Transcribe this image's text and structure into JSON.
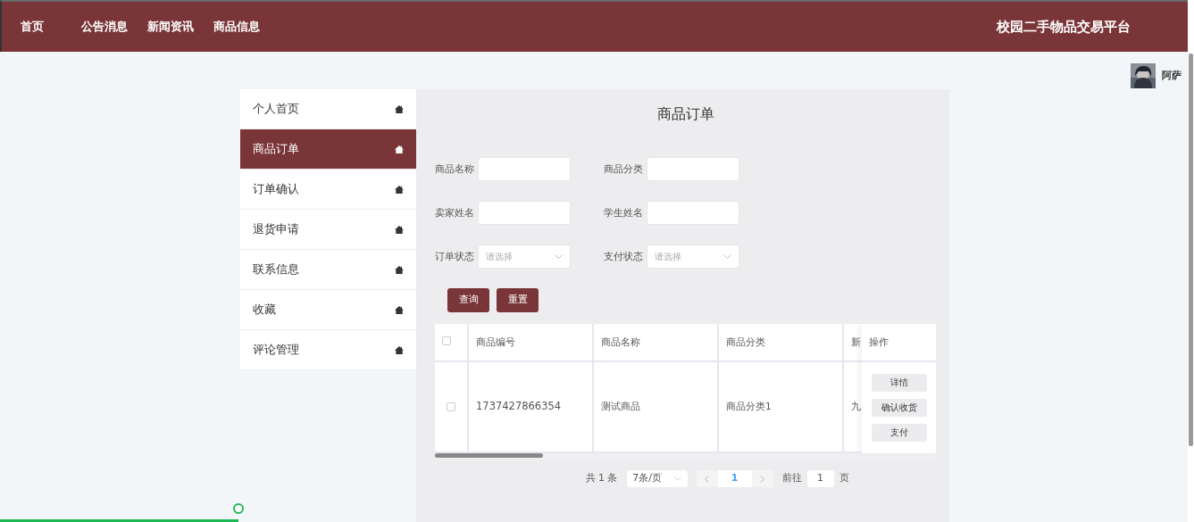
{
  "navbar": {
    "links": [
      {
        "label": "首页"
      },
      {
        "label": "公告消息"
      },
      {
        "label": "新闻资讯"
      },
      {
        "label": "商品信息"
      }
    ],
    "brand": "校园二手物品交易平台"
  },
  "user": {
    "name": "阿萨"
  },
  "sidebar": {
    "items": [
      {
        "label": "个人首页",
        "selected": false
      },
      {
        "label": "商品订单",
        "selected": true
      },
      {
        "label": "订单确认",
        "selected": false
      },
      {
        "label": "退货申请",
        "selected": false
      },
      {
        "label": "联系信息",
        "selected": false
      },
      {
        "label": "收藏",
        "selected": false
      },
      {
        "label": "评论管理",
        "selected": false
      }
    ]
  },
  "page_title": "商品订单",
  "filters": [
    {
      "label": "商品名称",
      "kind": "text"
    },
    {
      "label": "商品分类",
      "kind": "text"
    },
    {
      "label": "卖家姓名",
      "kind": "text"
    },
    {
      "label": "学生姓名",
      "kind": "text"
    },
    {
      "label": "订单状态",
      "kind": "select",
      "placeholder": "请选择"
    },
    {
      "label": "支付状态",
      "kind": "select",
      "placeholder": "请选择"
    }
  ],
  "filter_buttons": [
    "查询",
    "重置"
  ],
  "table": {
    "columns": [
      "商品编号",
      "商品名称",
      "商品分类",
      "新"
    ],
    "action_column": "操作",
    "rows": [
      {
        "checked": false,
        "cells": [
          "1737427866354",
          "测试商品",
          "商品分类1",
          "九"
        ],
        "actions": [
          "详情",
          "确认收货",
          "支付"
        ]
      }
    ],
    "header_checked": false
  },
  "pagination": {
    "total": "共 1 条",
    "page_size": "7条/页",
    "pages": [
      {
        "label": "1",
        "selected": true
      }
    ],
    "goto_label": "前往",
    "goto_value": "1",
    "goto_suffix": "页"
  },
  "bottom_progress": {
    "level": 0.2
  }
}
